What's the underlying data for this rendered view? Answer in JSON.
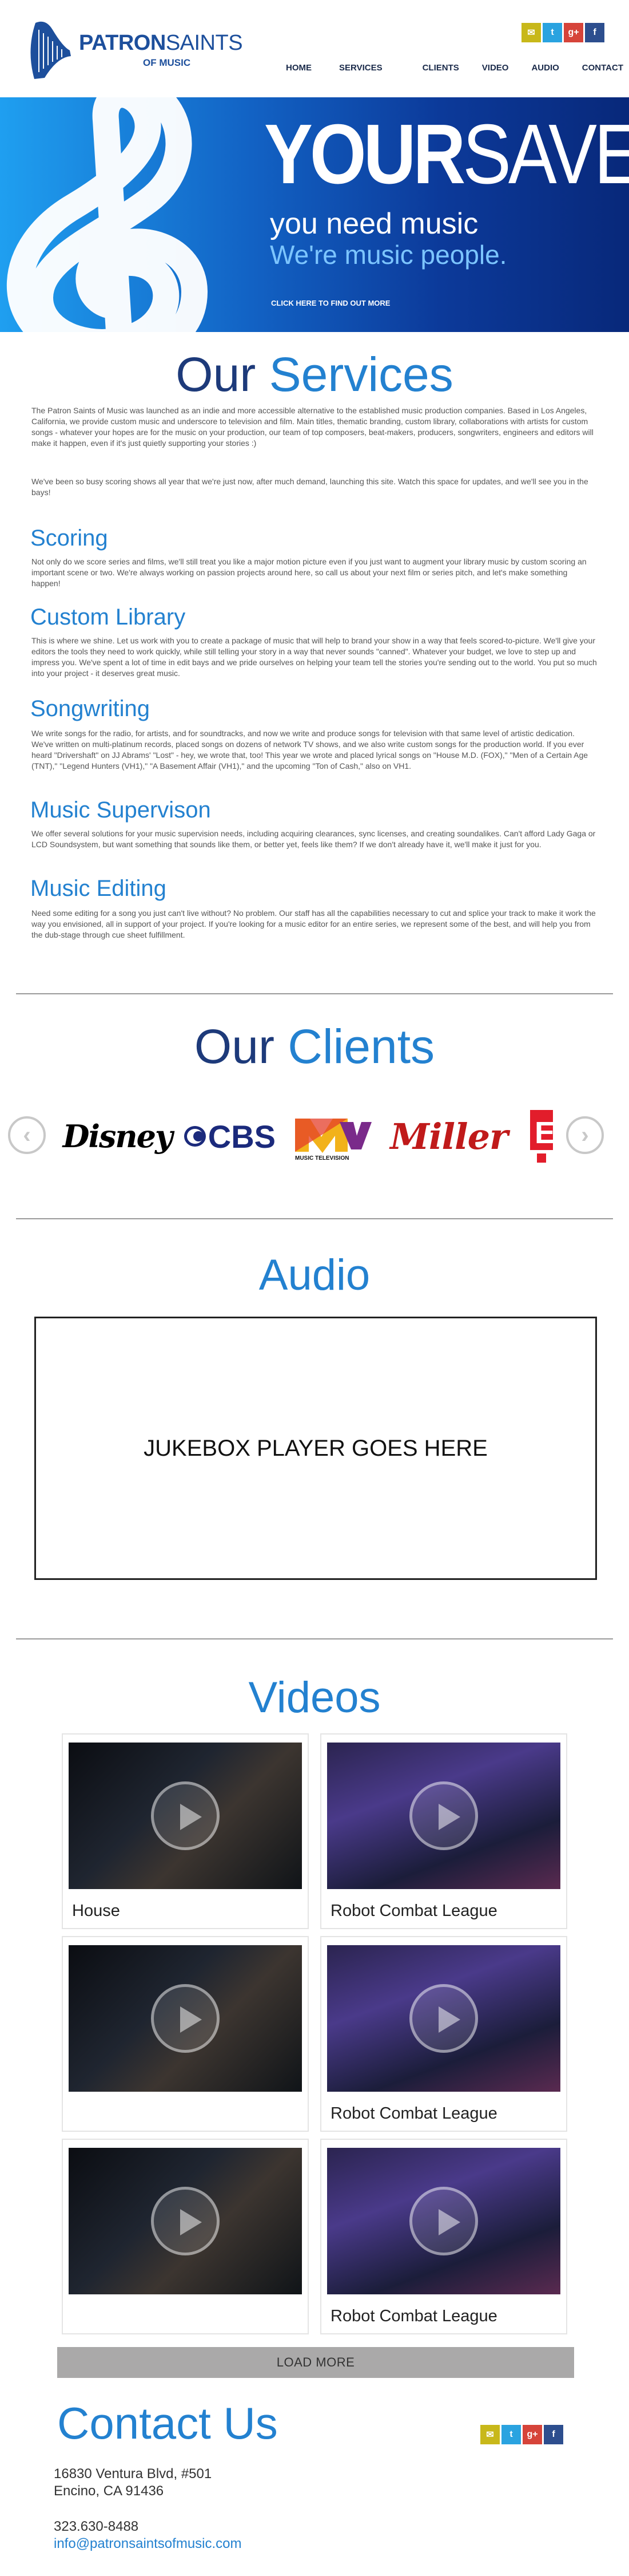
{
  "brand": {
    "name_part1": "PATRON",
    "name_part2": "SAINTS",
    "tagline": "OF MUSIC"
  },
  "social": [
    {
      "icon": "mail-icon",
      "glyph": "✉",
      "color": "#c8b81a"
    },
    {
      "icon": "twitter-icon",
      "glyph": "t",
      "color": "#2aa3e0"
    },
    {
      "icon": "google-plus-icon",
      "glyph": "g+",
      "color": "#d6443a"
    },
    {
      "icon": "facebook-icon",
      "glyph": "f",
      "color": "#2d4e8e"
    }
  ],
  "nav": [
    {
      "label": "HOME"
    },
    {
      "label": "SERVICES"
    },
    {
      "label": "CLIENTS"
    },
    {
      "label": "VIDEO"
    },
    {
      "label": "AUDIO"
    },
    {
      "label": "CONTACT"
    }
  ],
  "hero": {
    "title_part1": "YOUR",
    "title_part2": "SAVED!",
    "line1": "you need music",
    "line2": "We're music people.",
    "cta": "CLICK HERE TO FIND OUT MORE"
  },
  "services": {
    "title_part1": "Our",
    "title_part2": "Services",
    "intro1": "The Patron Saints of Music was launched as an indie and more accessible alternative to the established music production companies. Based in Los Angeles, California, we provide custom music and underscore to television and film.  Main titles, thematic branding, custom library, collaborations with artists for custom songs - whatever your hopes are for the music on your production, our team of top composers, beat-makers, producers, songwriters, engineers and editors will make it happen, even if it's just quietly supporting your stories :)",
    "intro2": "We've been so busy scoring shows all year that we're just now, after much demand, launching this site.  Watch this space for updates, and we'll see you in the bays!",
    "items": [
      {
        "title": "Scoring",
        "text": "Not only do we score series and films, we'll still treat you like a major motion picture even if you just want to augment your library music by custom scoring an important scene or two.  We're always working on passion projects around here, so call us about your next film or series pitch, and let's make something happen!"
      },
      {
        "title": "Custom Library",
        "text": "This is where we shine. Let us work with you to create a package of music that will help to brand your show in a way that feels scored-to-picture.  We'll give your editors the tools they need to work quickly, while still telling your story in a way that never sounds \"canned\". Whatever your budget, we love to step up and impress you. We've spent a lot of time in edit bays and we pride ourselves on helping your team tell the stories you're sending out to the world. You put so much into your project - it deserves great music."
      },
      {
        "title": "Songwriting",
        "text": "We write songs for the radio, for artists, and for soundtracks, and now we write and produce songs for television with that same level of artistic dedication.  We've written on multi-platinum records, placed songs on dozens of network TV shows, and we also write custom songs for the production world.  If you ever heard \"Drivershaft\" on JJ Abrams' \"Lost\" - hey, we wrote that, too!  This year we wrote and placed lyrical songs on \"House M.D. (FOX),\" \"Men of a Certain Age (TNT),\" \"Legend Hunters (VH1),\" \"A Basement Affair (VH1),\" and the upcoming \"Ton of Cash,\" also on VH1."
      },
      {
        "title": "Music Supervison",
        "text": "We offer several solutions for your music supervision needs, including acquiring clearances, sync licenses, and creating soundalikes.  Can't afford Lady Gaga or LCD Soundsystem, but want something that sounds like them, or better yet, feels like them?  If we don't already have it, we'll make it just for you."
      },
      {
        "title": "Music Editing",
        "text": "Need some editing for a song you just can't live without?  No problem.  Our staff has all the capabilities necessary to cut and splice your track to make it work the way you envisioned, all in support of your project.  If you're looking for a music editor for an entire series, we represent some of the best, and will help you from the dub-stage through cue sheet fulfillment."
      }
    ]
  },
  "clients": {
    "title_part1": "Our",
    "title_part2": "Clients",
    "logos": [
      {
        "name": "Disney",
        "text": "Disney"
      },
      {
        "name": "CBS",
        "text": "CBS"
      },
      {
        "name": "MTV",
        "text": "MTV",
        "sub": "MUSIC TELEVISION"
      },
      {
        "name": "Miller",
        "text": "Miller"
      },
      {
        "name": "E!",
        "text": "E"
      }
    ],
    "prev_glyph": "‹",
    "next_glyph": "›"
  },
  "audio": {
    "title": "Audio",
    "player_text": "JUKEBOX PLAYER GOES HERE"
  },
  "videos": {
    "title": "Videos",
    "items": [
      {
        "label": "House",
        "thumb": "house"
      },
      {
        "label": "Robot Combat League",
        "thumb": "robot"
      },
      {
        "label": "",
        "thumb": "house"
      },
      {
        "label": "Robot Combat League",
        "thumb": "robot"
      },
      {
        "label": "",
        "thumb": "house"
      },
      {
        "label": "Robot Combat League",
        "thumb": "robot"
      }
    ],
    "load_more": "LOAD MORE"
  },
  "contact": {
    "title": "Contact Us",
    "street": "16830 Ventura Blvd, #501",
    "city": "Encino, CA 91436",
    "phone": "323.630-8488",
    "email": "info@patronsaintsofmusic.com"
  },
  "colors": {
    "accent": "#2381d0",
    "navy": "#1d3a7a",
    "hero_start": "#1f9ff0",
    "hero_end": "#08287a"
  }
}
